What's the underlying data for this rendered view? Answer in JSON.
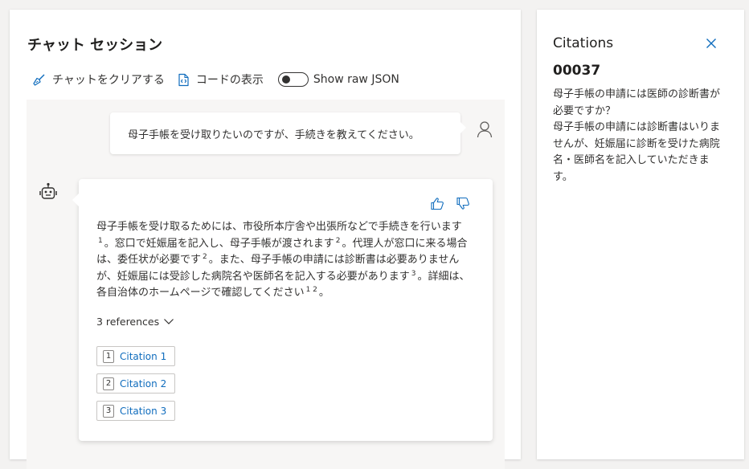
{
  "chat": {
    "title": "チャット セッション",
    "toolbar": {
      "clear_label": "チャットをクリアする",
      "code_label": "コードの表示",
      "raw_json_label": "Show raw JSON",
      "raw_json_on": false
    },
    "user_message": "母子手帳を受け取りたいのですが、手続きを教えてください。",
    "bot_message": {
      "segments": [
        {
          "text": "母子手帳を受け取るためには、市役所本庁舎や出張所などで手続きを行います",
          "sup": "1"
        },
        {
          "text": "。窓口で妊娠届を記入し、母子手帳が渡されます",
          "sup": "2"
        },
        {
          "text": "。代理人が窓口に来る場合は、委任状が必要です",
          "sup": "2"
        },
        {
          "text": "。また、母子手帳の申請には診断書は必要ありませんが、妊娠届には受診した病院名や医師名を記入する必要があります",
          "sup": "3"
        },
        {
          "text": "。詳細は、各自治体のホームページで確認してください",
          "sup": "1 2"
        },
        {
          "text": "。",
          "sup": ""
        }
      ],
      "references_label": "3 references",
      "citations": [
        {
          "num": "1",
          "label": "Citation 1"
        },
        {
          "num": "2",
          "label": "Citation 2"
        },
        {
          "num": "3",
          "label": "Citation 3"
        }
      ]
    }
  },
  "citations_panel": {
    "title": "Citations",
    "id": "00037",
    "question": "母子手帳の申請には医師の診断書が必要ですか？",
    "answer": "母子手帳の申請には診断書はいりませんが、妊娠届に診断を受けた病院名・医師名を記入していただきます。"
  },
  "icons": {
    "clear": "broom-icon",
    "code": "code-file-icon",
    "user": "person-icon",
    "bot": "bot-icon",
    "like": "thumbs-up-icon",
    "dislike": "thumbs-down-icon",
    "expand": "chevron-down-icon",
    "close": "close-icon"
  },
  "colors": {
    "accent": "#0f6cbd",
    "background": "#f3f2f1",
    "chat_area": "#f7f6f5"
  }
}
